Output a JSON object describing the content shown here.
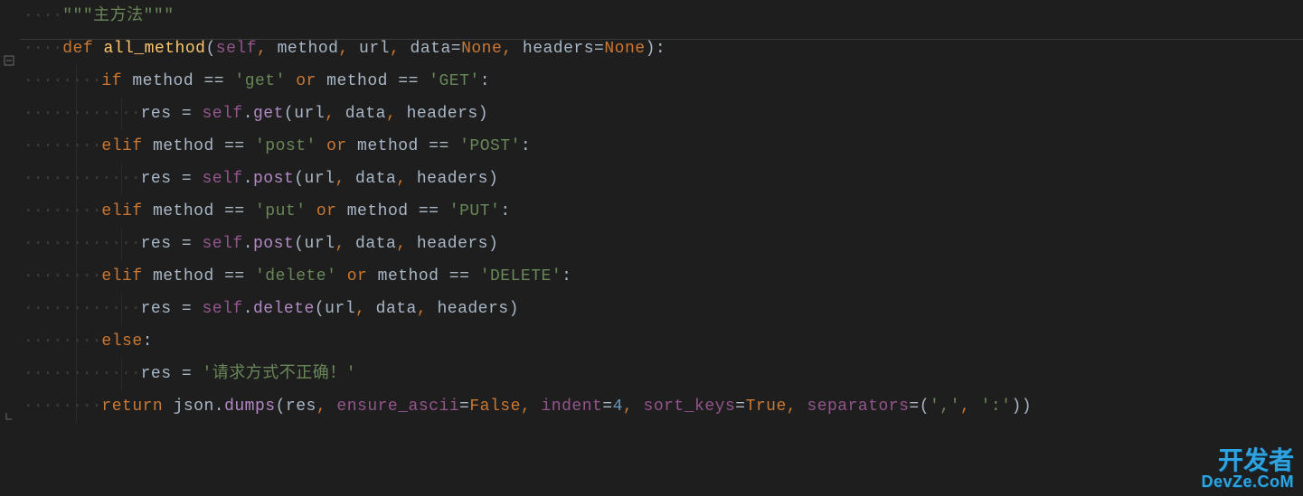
{
  "code": {
    "docstring": "\"\"\"主方法\"\"\"",
    "def_kw": "def",
    "fn_name": "all_method",
    "params": {
      "self": "self",
      "method": "method",
      "url": "url",
      "data": "data",
      "none1": "None",
      "headers": "headers",
      "none2": "None"
    },
    "if_kw": "if",
    "elif_kw": "elif",
    "else_kw": "else",
    "or_kw": "or",
    "return_kw": "return",
    "method_ident": "method",
    "eq": "==",
    "assign": "=",
    "res": "res",
    "self_get": "self",
    "dot": ".",
    "get_call": "get",
    "post_call": "post",
    "delete_call": "delete",
    "url_ident": "url",
    "data_ident": "data",
    "headers_ident": "headers",
    "s_get_l": "'get'",
    "s_get_u": "'GET'",
    "s_post_l": "'post'",
    "s_post_u": "'POST'",
    "s_put_l": "'put'",
    "s_put_u": "'PUT'",
    "s_delete_l": "'delete'",
    "s_delete_u": "'DELETE'",
    "s_error": "'请求方式不正确！'",
    "json_ident": "json",
    "dumps": "dumps",
    "ensure_ascii": "ensure_ascii",
    "false": "False",
    "indent_kw": "indent",
    "four": "4",
    "sort_keys": "sort_keys",
    "true": "True",
    "separators": "separators",
    "sep_comma": "','",
    "sep_colon": "':'"
  },
  "watermark": {
    "top": "开发者",
    "bottom": "DevZe.CoM"
  }
}
